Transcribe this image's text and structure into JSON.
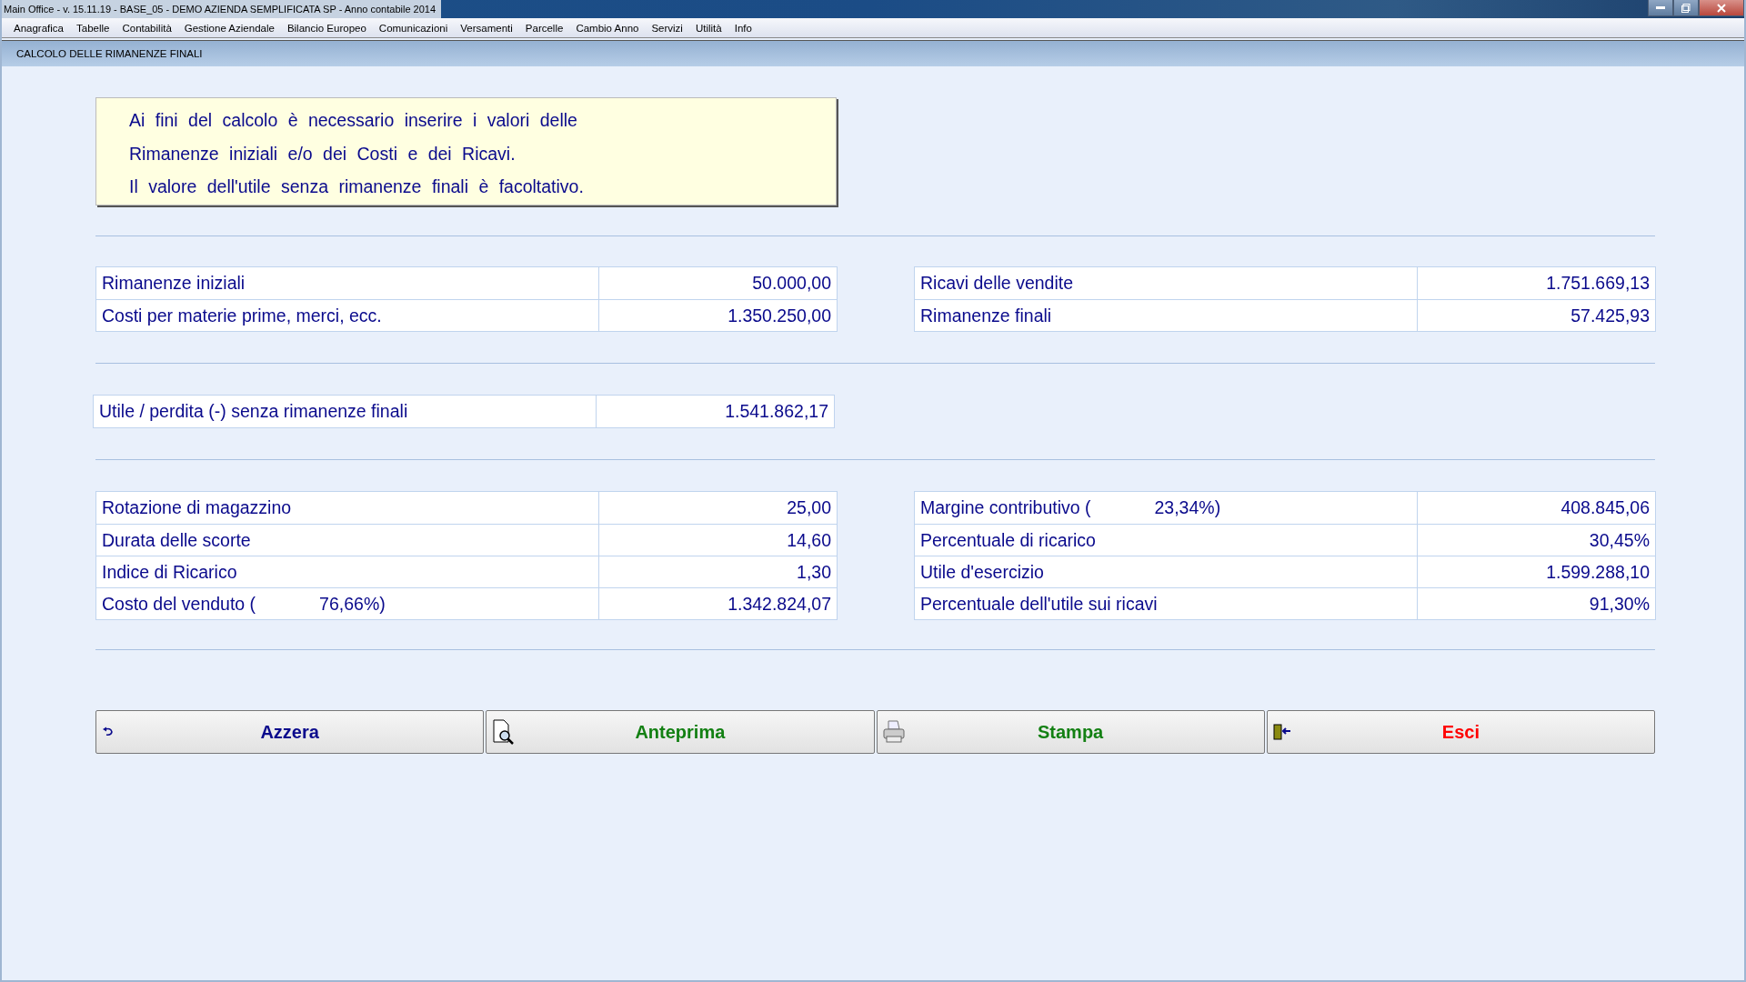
{
  "window": {
    "title": "Main Office - v. 15.11.19 - BASE_05 - DEMO AZIENDA SEMPLIFICATA SP - Anno contabile 2014"
  },
  "menu": [
    "Anagrafica",
    "Tabelle",
    "Contabilità",
    "Gestione Aziendale",
    "Bilancio Europeo",
    "Comunicazioni",
    "Versamenti",
    "Parcelle",
    "Cambio Anno",
    "Servizi",
    "Utilità",
    "Info"
  ],
  "form_title": "CALCOLO DELLE RIMANENZE FINALI",
  "info_lines": [
    "Ai fini del calcolo è necessario inserire i valori delle",
    "Rimanenze iniziali e/o dei Costi e dei Ricavi.",
    "Il valore dell'utile senza rimanenze finali è facoltativo."
  ],
  "inputs_left": [
    {
      "label": "Rimanenze iniziali",
      "value": "50.000,00"
    },
    {
      "label": "Costi per materie prime, merci, ecc.",
      "value": "1.350.250,00"
    }
  ],
  "inputs_right": [
    {
      "label": "Ricavi delle vendite",
      "value": "1.751.669,13"
    },
    {
      "label": "Rimanenze finali",
      "value": "57.425,93"
    }
  ],
  "profit_row": {
    "label": "Utile / perdita (-) senza rimanenze finali",
    "value": "1.541.862,17"
  },
  "results_left": [
    {
      "label": "Rotazione di magazzino",
      "value": "25,00"
    },
    {
      "label": "Durata delle scorte",
      "value": "14,60"
    },
    {
      "label": "Indice di Ricarico",
      "value": "1,30"
    },
    {
      "label": "Costo del venduto (",
      "pct": "76,66%)",
      "value": "1.342.824,07"
    }
  ],
  "results_right": [
    {
      "label": "Margine contributivo (",
      "pct": "23,34%)",
      "value": "408.845,06"
    },
    {
      "label": "Percentuale di ricarico",
      "value": "30,45%"
    },
    {
      "label": "Utile d'esercizio",
      "value": "1.599.288,10"
    },
    {
      "label": "Percentuale dell'utile sui ricavi",
      "value": "91,30%"
    }
  ],
  "buttons": [
    {
      "label": "Azzera",
      "kind": "reset"
    },
    {
      "label": "Anteprima",
      "kind": "preview"
    },
    {
      "label": "Stampa",
      "kind": "print"
    },
    {
      "label": "Esci",
      "kind": "exit"
    }
  ]
}
